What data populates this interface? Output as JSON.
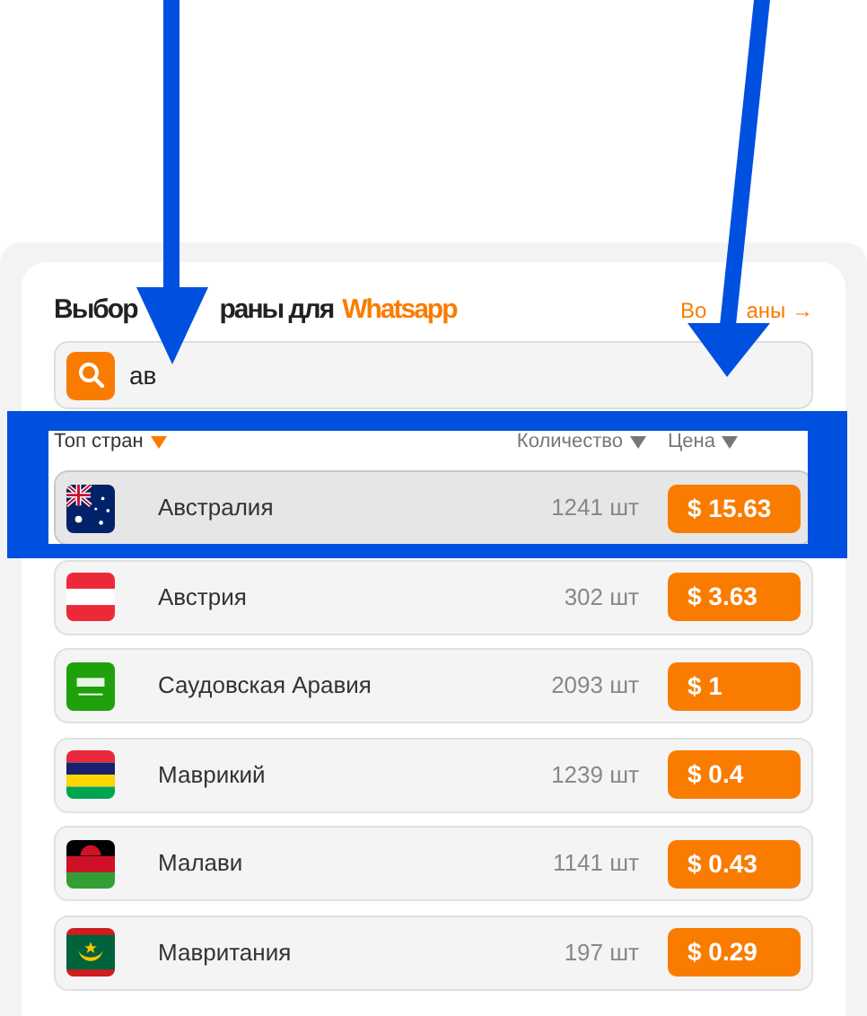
{
  "title": {
    "start": "Выбор",
    "end": "раны для",
    "brand": "Whatsapp"
  },
  "all_link": {
    "start": "Во",
    "end": "аны →"
  },
  "search": {
    "value": "ав"
  },
  "columns": [
    {
      "label": "Топ стран",
      "sorted": true
    },
    {
      "label": "Количество",
      "sorted": false
    },
    {
      "label": "Цена",
      "sorted": false
    }
  ],
  "rows": [
    {
      "kind": "australia",
      "name": "Австралия",
      "count": "1241 шт",
      "price": "$ 15.63",
      "selected": true
    },
    {
      "kind": "austria",
      "name": "Австрия",
      "count": "302 шт",
      "price": "$ 3.63",
      "selected": false
    },
    {
      "kind": "saudi",
      "name": "Саудовская Аравия",
      "count": "2093 шт",
      "price": "$ 1",
      "selected": false
    },
    {
      "kind": "mauritius",
      "name": "Маврикий",
      "count": "1239 шт",
      "price": "$ 0.4",
      "selected": false
    },
    {
      "kind": "malawi",
      "name": "Малави",
      "count": "1141 шт",
      "price": "$ 0.43",
      "selected": false
    },
    {
      "kind": "mauritania",
      "name": "Мавритания",
      "count": "197 шт",
      "price": "$ 0.29",
      "selected": false
    }
  ]
}
